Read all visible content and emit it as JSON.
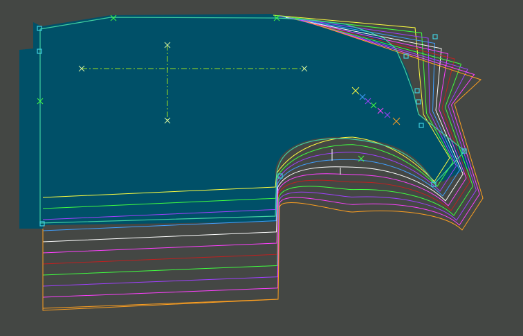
{
  "canvas": {
    "background": "#444744",
    "fill_color": "#005068",
    "grade_colors": [
      "#ffff40",
      "#40ff40",
      "#a040ff",
      "#40a0ff",
      "#ffffff",
      "#ff40ff",
      "#c02020",
      "#40ff40",
      "#a040ff",
      "#ff40ff",
      "#ffa020"
    ],
    "marker_color": "#40d0e0",
    "grainline_color": "#a0e020"
  },
  "icons": {
    "grade_point": "square-marker",
    "notch": "cross-marker",
    "grainline": "dash-dot-crosshair"
  }
}
